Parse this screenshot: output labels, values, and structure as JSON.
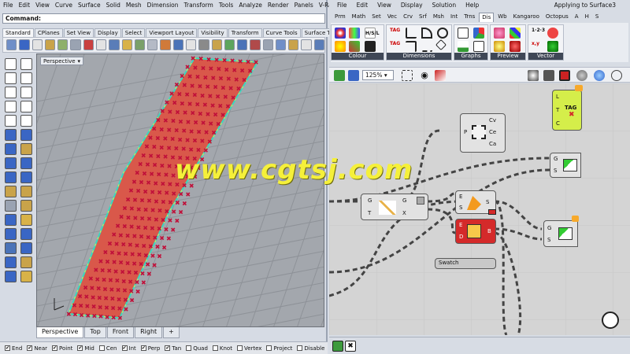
{
  "rhino": {
    "menu": [
      "File",
      "Edit",
      "View",
      "Curve",
      "Surface",
      "Solid",
      "Mesh",
      "Dimension",
      "Transform",
      "Tools",
      "Analyze",
      "Render",
      "Panels",
      "V-Ra"
    ],
    "command_label": "Command:",
    "toolbar_tabs": [
      "Standard",
      "CPlanes",
      "Set View",
      "Display",
      "Select",
      "Viewport Layout",
      "Visibility",
      "Transform",
      "Curve Tools",
      "Surface Tools"
    ],
    "viewport_label": "Perspective",
    "view_tabs": [
      "Perspective",
      "Top",
      "Front",
      "Right"
    ],
    "view_tab_add": "+",
    "osnaps": [
      {
        "label": "End",
        "checked": true
      },
      {
        "label": "Near",
        "checked": true
      },
      {
        "label": "Point",
        "checked": true
      },
      {
        "label": "Mid",
        "checked": true
      },
      {
        "label": "Cen",
        "checked": false
      },
      {
        "label": "Int",
        "checked": true
      },
      {
        "label": "Perp",
        "checked": true
      },
      {
        "label": "Tan",
        "checked": true
      },
      {
        "label": "Quad",
        "checked": false
      },
      {
        "label": "Knot",
        "checked": false
      },
      {
        "label": "Vertex",
        "checked": false
      },
      {
        "label": "Project",
        "checked": false
      },
      {
        "label": "Disable",
        "checked": false
      }
    ]
  },
  "grasshopper": {
    "menu": [
      "File",
      "Edit",
      "View",
      "Display",
      "Solution",
      "Help"
    ],
    "title": "Applying to Surface3",
    "tabs": [
      "Prm",
      "Math",
      "Set",
      "Vec",
      "Crv",
      "Srf",
      "Msh",
      "Int",
      "Trns",
      "Dis",
      "Wb",
      "Kangaroo",
      "Octopus",
      "A",
      "H",
      "S"
    ],
    "active_tab": "Dis",
    "ribbon_groups": [
      "Colour",
      "Dimensions",
      "Graphs",
      "Preview",
      "Vector"
    ],
    "zoom": "125%",
    "components": {
      "area": {
        "input": "P",
        "outputs": [
          "Cv",
          "Ce",
          "Ca"
        ]
      },
      "tag": {
        "inputs": [
          "L",
          "T",
          "C"
        ],
        "icon_text": "TAG"
      },
      "preview_top": {
        "inputs": [
          "G",
          "S"
        ]
      },
      "vector_display": {
        "inputs": [
          "G",
          "T"
        ],
        "outputs": [
          "G",
          "X"
        ]
      },
      "gradient": {
        "inputs": [
          "E",
          "S"
        ],
        "output": "S"
      },
      "red_comp": {
        "inputs": [
          "E",
          "D"
        ],
        "output": "B"
      },
      "preview_bottom": {
        "inputs": [
          "G",
          "S"
        ]
      },
      "swatch": {
        "label": "Swatch"
      }
    }
  },
  "watermark": "www.cgtsj.com",
  "colors": {
    "accent_red": "#d42a2a",
    "tag_green": "#d5ee4a",
    "watermark": "#f5f03a"
  }
}
